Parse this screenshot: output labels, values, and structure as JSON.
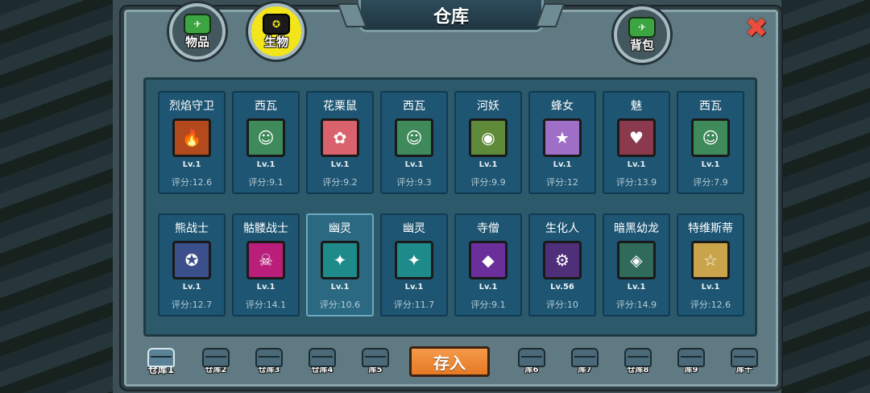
{
  "window": {
    "title": "仓库"
  },
  "tabs": [
    {
      "label": "物品",
      "icon": "cannon-icon",
      "active": false
    },
    {
      "label": "生物",
      "icon": "creature-icon",
      "active": true
    }
  ],
  "backpack": {
    "label": "背包",
    "icon": "cannon-icon"
  },
  "close": {
    "glyph": "✖"
  },
  "cards": [
    {
      "name": "烈焰守卫",
      "level": "Lv.1",
      "score": "评分:12.6",
      "color": "#b34a1e",
      "glyph": "🔥"
    },
    {
      "name": "西瓦",
      "level": "Lv.1",
      "score": "评分:9.1",
      "color": "#3f8a5a",
      "glyph": "☺"
    },
    {
      "name": "花栗鼠",
      "level": "Lv.1",
      "score": "评分:9.2",
      "color": "#d9626c",
      "glyph": "✿"
    },
    {
      "name": "西瓦",
      "level": "Lv.1",
      "score": "评分:9.3",
      "color": "#3f8a5a",
      "glyph": "☺"
    },
    {
      "name": "河妖",
      "level": "Lv.1",
      "score": "评分:9.9",
      "color": "#5e8a3a",
      "glyph": "◉"
    },
    {
      "name": "蜂女",
      "level": "Lv.1",
      "score": "评分:12",
      "color": "#9f6fc7",
      "glyph": "★"
    },
    {
      "name": "魅",
      "level": "Lv.1",
      "score": "评分:13.9",
      "color": "#8a3a4c",
      "glyph": "♥"
    },
    {
      "name": "西瓦",
      "level": "Lv.1",
      "score": "评分:7.9",
      "color": "#3f8a5a",
      "glyph": "☺"
    },
    {
      "name": "熊战士",
      "level": "Lv.1",
      "score": "评分:12.7",
      "color": "#3b4f8a",
      "glyph": "✪"
    },
    {
      "name": "骷髅战士",
      "level": "Lv.1",
      "score": "评分:14.1",
      "color": "#b81e7a",
      "glyph": "☠"
    },
    {
      "name": "幽灵",
      "level": "Lv.1",
      "score": "评分:10.6",
      "color": "#1e8a8a",
      "glyph": "✦",
      "selected": true
    },
    {
      "name": "幽灵",
      "level": "Lv.1",
      "score": "评分:11.7",
      "color": "#1e8a8a",
      "glyph": "✦"
    },
    {
      "name": "寺僧",
      "level": "Lv.1",
      "score": "评分:9.1",
      "color": "#6a2f9a",
      "glyph": "◆"
    },
    {
      "name": "生化人",
      "level": "Lv.56",
      "score": "评分:10",
      "color": "#4f2f7a",
      "glyph": "⚙"
    },
    {
      "name": "暗黑幼龙",
      "level": "Lv.1",
      "score": "评分:14.9",
      "color": "#2f6a5a",
      "glyph": "◈"
    },
    {
      "name": "特维斯蒂",
      "level": "Lv.1",
      "score": "评分:12.6",
      "color": "#c9a44a",
      "glyph": "☆"
    }
  ],
  "stores": [
    {
      "label": "仓库1",
      "active": true
    },
    {
      "label": "仓库2"
    },
    {
      "label": "仓库3"
    },
    {
      "label": "仓库4"
    },
    {
      "label": "库5"
    },
    {
      "label": "库6"
    },
    {
      "label": "库7"
    },
    {
      "label": "仓库8"
    },
    {
      "label": "库9"
    },
    {
      "label": "库十"
    }
  ],
  "deposit": {
    "label": "存入"
  }
}
